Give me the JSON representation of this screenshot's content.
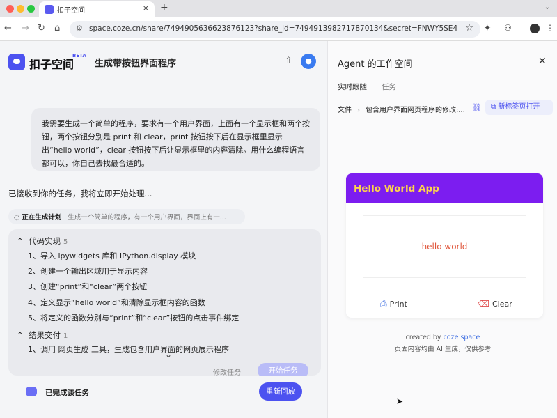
{
  "browser": {
    "tab_title": "扣子空间",
    "tab_close": "×",
    "new_tab": "+",
    "tab_menu": "⌄",
    "url": "space.coze.cn/share/7494905636623876123?share_id=7494913982717870134&secret=FNWY5SE4",
    "nav_back": "←",
    "nav_forward": "→",
    "nav_reload": "↻",
    "nav_home": "⌂"
  },
  "header": {
    "logo_text": "扣子空间",
    "beta": "BETA",
    "title": "生成带按钮界面程序"
  },
  "chat": {
    "user_message": "我需要生成一个简单的程序，要求有一个用户界面，上面有一个显示框和两个按钮，两个按钮分别是 print 和 clear，print 按钮按下后在显示框里显示出“hello world”，clear 按钮按下后让显示框里的内容清除。用什么编程语言都可以，你自己去找最合适的。",
    "ack": "已接收到你的任务，我将立即开始处理...",
    "plan_chip_label": "正在生成计划",
    "plan_chip_text": "生成一个简单的程序，有一个用户界面，界面上有一..."
  },
  "plan": {
    "section1_title": "代码实现",
    "section1_count": "5",
    "steps": [
      "1、导入 ipywidgets 库和 IPython.display 模块",
      "2、创建一个输出区域用于显示内容",
      "3、创建“print”和“clear”两个按钮",
      "4、定义显示“hello world”和清除显示框内容的函数",
      "5、将定义的函数分别与“print”和“clear”按钮的点击事件绑定"
    ],
    "section2_title": "结果交付",
    "section2_count": "1",
    "steps2": [
      "1、调用 网页生成 工具，生成包含用户界面的网页展示程序"
    ],
    "modify_label": "修改任务",
    "start_label": "开始任务"
  },
  "footer": {
    "done_text": "已完成该任务",
    "replay_label": "重新回放"
  },
  "panel": {
    "title": "Agent 的工作空间",
    "tab_live": "实时跟随",
    "tab_tasks": "任务",
    "crumb_root": "文件",
    "crumb_file": "包含用户界面网页程序的修改:...",
    "open_new_tab": "新标签页打开"
  },
  "preview": {
    "header_title": "Hello World App",
    "display_text": "hello world",
    "print_label": "Print",
    "clear_label": "Clear",
    "credit_prefix": "created by",
    "credit_brand": "coze space",
    "disclaimer": "页面内容均由 AI 生成，仅供参考"
  },
  "colors": {
    "accent": "#4c52f0",
    "preview_header": "#7c1df0",
    "preview_title": "#ffd54a"
  }
}
